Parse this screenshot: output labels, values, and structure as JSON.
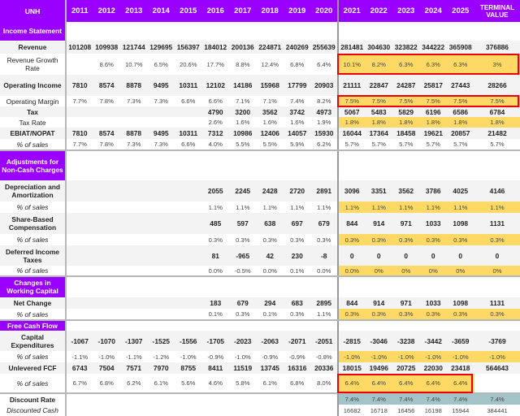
{
  "header": {
    "ticker": "UNH",
    "years": [
      "2011",
      "2012",
      "2013",
      "2014",
      "2015",
      "2016",
      "2017",
      "2018",
      "2019",
      "2020",
      "2021",
      "2022",
      "2023",
      "2024",
      "2025"
    ],
    "terminal_label": "TERMINAL VALUE"
  },
  "colors": {
    "section_purple": "#9900ff",
    "assumption_yellow": "#ffd966",
    "discount_teal": "#a2c4c9",
    "highlight_red": "#ee0000"
  },
  "sections": {
    "income": "Income Statement",
    "adjust": "Adjustments for Non-Cash Charges",
    "wc": "Changes in Working Capital",
    "fcf": "Free Cash Flow"
  },
  "rows": {
    "revenue": {
      "label": "Revenue",
      "values": [
        "101208",
        "109938",
        "121744",
        "129695",
        "156397",
        "184012",
        "200136",
        "224871",
        "240269",
        "255639",
        "281481",
        "304630",
        "323822",
        "344222",
        "365908",
        "376886"
      ]
    },
    "rev_growth": {
      "label": "Revenue Growth Rate",
      "values": [
        "",
        "8.6%",
        "10.7%",
        "6.5%",
        "20.6%",
        "17.7%",
        "8.8%",
        "12.4%",
        "6.8%",
        "6.4%",
        "10.1%",
        "8.2%",
        "6.3%",
        "6.3%",
        "6.3%",
        "3%"
      ]
    },
    "op_income": {
      "label": "Operating Income",
      "values": [
        "7810",
        "8574",
        "8878",
        "9495",
        "10311",
        "12102",
        "14186",
        "15968",
        "17799",
        "20903",
        "21111",
        "22847",
        "24287",
        "25817",
        "27443",
        "28266"
      ]
    },
    "op_margin": {
      "label": "Operating Margin",
      "values": [
        "7.7%",
        "7.8%",
        "7.3%",
        "7.3%",
        "6.6%",
        "6.6%",
        "7.1%",
        "7.1%",
        "7.4%",
        "8.2%",
        "7.5%",
        "7.5%",
        "7.5%",
        "7.5%",
        "7.5%",
        "7.5%"
      ]
    },
    "tax": {
      "label": "Tax",
      "values": [
        "",
        "",
        "",
        "",
        "",
        "4790",
        "3200",
        "3562",
        "3742",
        "4973",
        "5067",
        "5483",
        "5829",
        "6196",
        "6586",
        "6784"
      ]
    },
    "tax_rate": {
      "label": "Tax Rate",
      "values": [
        "",
        "",
        "",
        "",
        "",
        "2.6%",
        "1.6%",
        "1.6%",
        "1.6%",
        "1.9%",
        "1.8%",
        "1.8%",
        "1.8%",
        "1.8%",
        "1.8%",
        "1.8%"
      ]
    },
    "nopat": {
      "label": "EBIAT/NOPAT",
      "values": [
        "7810",
        "8574",
        "8878",
        "9495",
        "10311",
        "7312",
        "10986",
        "12406",
        "14057",
        "15930",
        "16044",
        "17364",
        "18458",
        "19621",
        "20857",
        "21482"
      ]
    },
    "nopat_pct": {
      "label": "% of sales",
      "values": [
        "7.7%",
        "7.8%",
        "7.3%",
        "7.3%",
        "6.6%",
        "4.0%",
        "5.5%",
        "5.5%",
        "5.9%",
        "6.2%",
        "5.7%",
        "5.7%",
        "5.7%",
        "5.7%",
        "5.7%",
        "5.7%"
      ]
    },
    "da": {
      "label": "Depreciation and Amortization",
      "values": [
        "",
        "",
        "",
        "",
        "",
        "2055",
        "2245",
        "2428",
        "2720",
        "2891",
        "3096",
        "3351",
        "3562",
        "3786",
        "4025",
        "4146"
      ]
    },
    "da_pct": {
      "label": "% of sales",
      "values": [
        "",
        "",
        "",
        "",
        "",
        "1.1%",
        "1.1%",
        "1.1%",
        "1.1%",
        "1.1%",
        "1.1%",
        "1.1%",
        "1.1%",
        "1.1%",
        "1.1%",
        "1.1%"
      ]
    },
    "sbc": {
      "label": "Share-Based Compensation",
      "values": [
        "",
        "",
        "",
        "",
        "",
        "485",
        "597",
        "638",
        "697",
        "679",
        "844",
        "914",
        "971",
        "1033",
        "1098",
        "1131"
      ]
    },
    "sbc_pct": {
      "label": "% of sales",
      "values": [
        "",
        "",
        "",
        "",
        "",
        "0.3%",
        "0.3%",
        "0.3%",
        "0.3%",
        "0.3%",
        "0.3%",
        "0.3%",
        "0.3%",
        "0.3%",
        "0.3%",
        "0.3%"
      ]
    },
    "dit": {
      "label": "Deferred Income Taxes",
      "values": [
        "",
        "",
        "",
        "",
        "",
        "81",
        "-965",
        "42",
        "230",
        "-8",
        "0",
        "0",
        "0",
        "0",
        "0",
        "0"
      ]
    },
    "dit_pct": {
      "label": "% of sales",
      "values": [
        "",
        "",
        "",
        "",
        "",
        "0.0%",
        "-0.5%",
        "0.0%",
        "0.1%",
        "0.0%",
        "0.0%",
        "0%",
        "0%",
        "0%",
        "0%",
        "0%"
      ]
    },
    "nwc": {
      "label": "Net Change",
      "values": [
        "",
        "",
        "",
        "",
        "",
        "183",
        "679",
        "294",
        "683",
        "2895",
        "844",
        "914",
        "971",
        "1033",
        "1098",
        "1131"
      ]
    },
    "nwc_pct": {
      "label": "% of sales",
      "values": [
        "",
        "",
        "",
        "",
        "",
        "0.1%",
        "0.3%",
        "0.1%",
        "0.3%",
        "1.1%",
        "0.3%",
        "0.3%",
        "0.3%",
        "0.3%",
        "0.3%",
        "0.3%"
      ]
    },
    "capex": {
      "label": "Capital Expenditures",
      "values": [
        "-1067",
        "-1070",
        "-1307",
        "-1525",
        "-1556",
        "-1705",
        "-2023",
        "-2063",
        "-2071",
        "-2051",
        "-2815",
        "-3046",
        "-3238",
        "-3442",
        "-3659",
        "-3769"
      ]
    },
    "capex_pct": {
      "label": "% of sales",
      "values": [
        "-1.1%",
        "-1.0%",
        "-1.1%",
        "-1.2%",
        "-1.0%",
        "-0.9%",
        "-1.0%",
        "-0.9%",
        "-0.9%",
        "-0.8%",
        "-1.0%",
        "-1.0%",
        "-1.0%",
        "-1.0%",
        "-1.0%",
        "-1.0%"
      ]
    },
    "ufcf": {
      "label": "Unlevered FCF",
      "values": [
        "6743",
        "7504",
        "7571",
        "7970",
        "8755",
        "8411",
        "11519",
        "13745",
        "16316",
        "20336",
        "18015",
        "19496",
        "20725",
        "22030",
        "23418",
        "564643"
      ]
    },
    "ufcf_pct": {
      "label": "% of sales",
      "values": [
        "6.7%",
        "6.8%",
        "6.2%",
        "6.1%",
        "5.6%",
        "4.6%",
        "5.8%",
        "6.1%",
        "6.8%",
        "8.0%",
        "6.4%",
        "6.4%",
        "6.4%",
        "6.4%",
        "6.4%",
        ""
      ]
    },
    "disc_rate": {
      "label": "Discount Rate",
      "values": [
        "",
        "",
        "",
        "",
        "",
        "",
        "",
        "",
        "",
        "",
        "7.4%",
        "7.4%",
        "7.4%",
        "7.4%",
        "7.4%",
        "7.4%"
      ]
    },
    "disc_cash": {
      "label": "Discounted Cash",
      "values": [
        "",
        "",
        "",
        "",
        "",
        "",
        "",
        "",
        "",
        "",
        "16682",
        "16718",
        "16456",
        "16198",
        "15944",
        "384441"
      ]
    }
  }
}
